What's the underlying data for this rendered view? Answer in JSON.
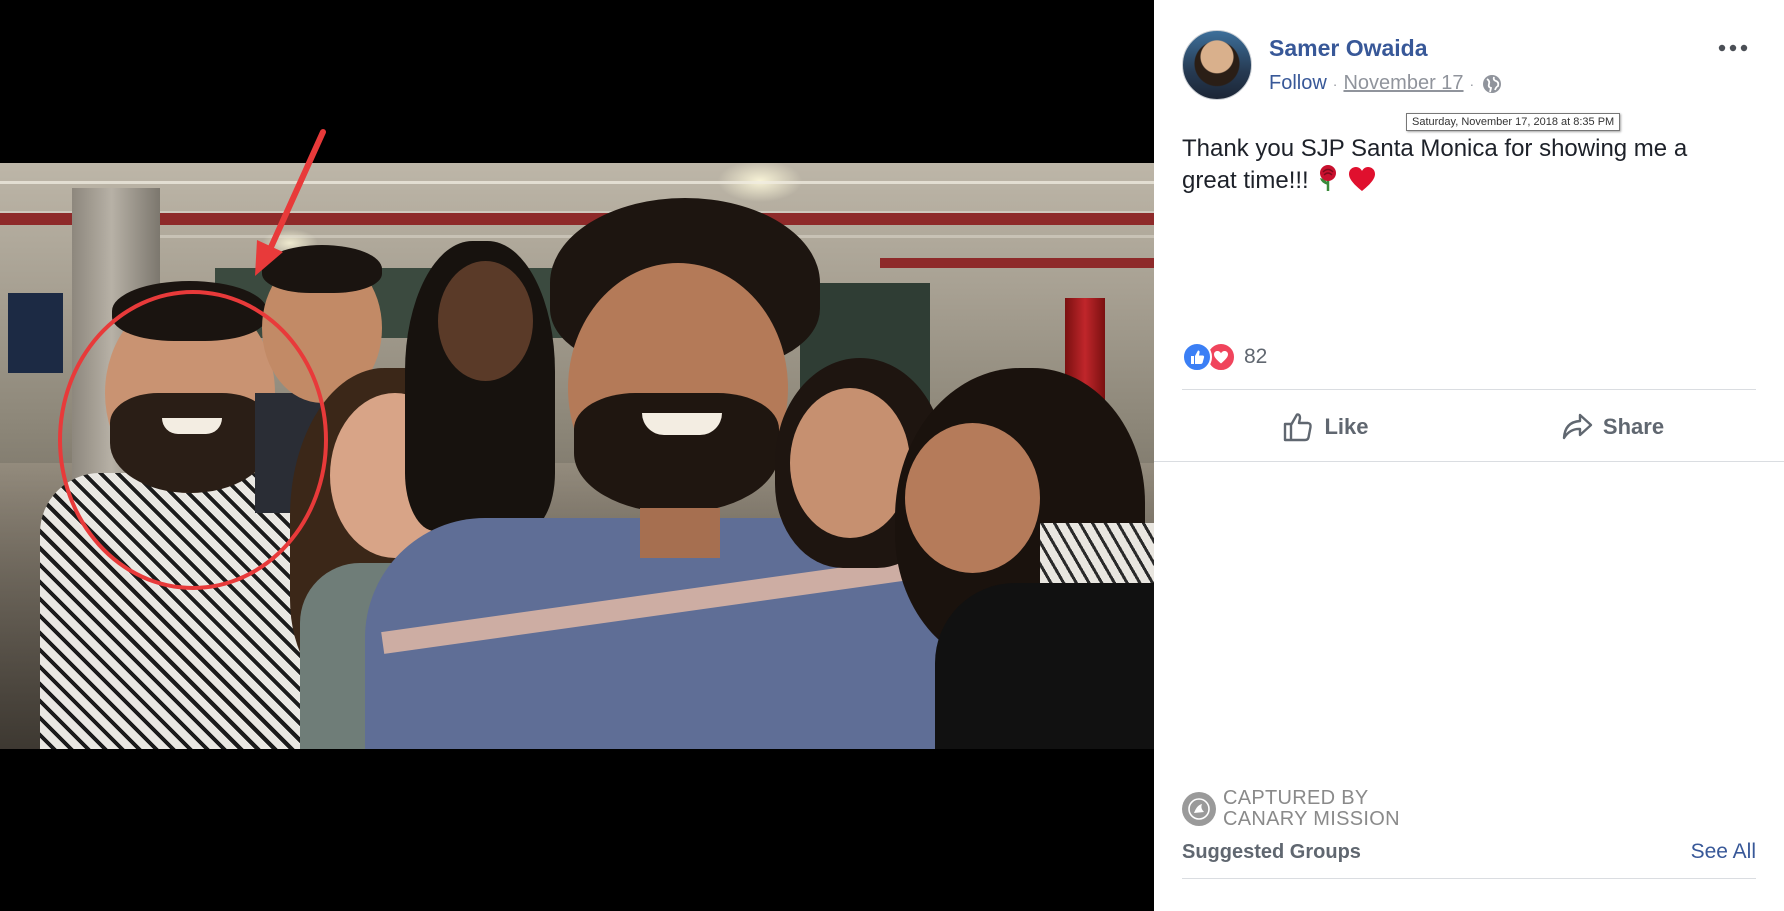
{
  "post": {
    "author": "Samer Owaida",
    "follow_label": "Follow",
    "date": "November 17",
    "date_tooltip": "Saturday, November 17, 2018 at 8:35 PM",
    "privacy_icon": "globe-icon",
    "text": "Thank you SJP Santa Monica for showing me a great time!!!",
    "emojis": [
      "rose-emoji",
      "red-heart-emoji"
    ],
    "reaction_types": [
      "like-reaction-icon",
      "love-reaction-icon"
    ],
    "reaction_count": "82"
  },
  "actions": {
    "like_label": "Like",
    "share_label": "Share"
  },
  "watermark": {
    "line1": "CAPTURED BY",
    "line2": "CANARY MISSION"
  },
  "suggested": {
    "title": "Suggested Groups",
    "see_all_label": "See All"
  },
  "colors": {
    "link_blue": "#385898",
    "annotation_red": "#e83a3a",
    "like_blue": "#3b7ff5",
    "love_red": "#f0445c"
  }
}
